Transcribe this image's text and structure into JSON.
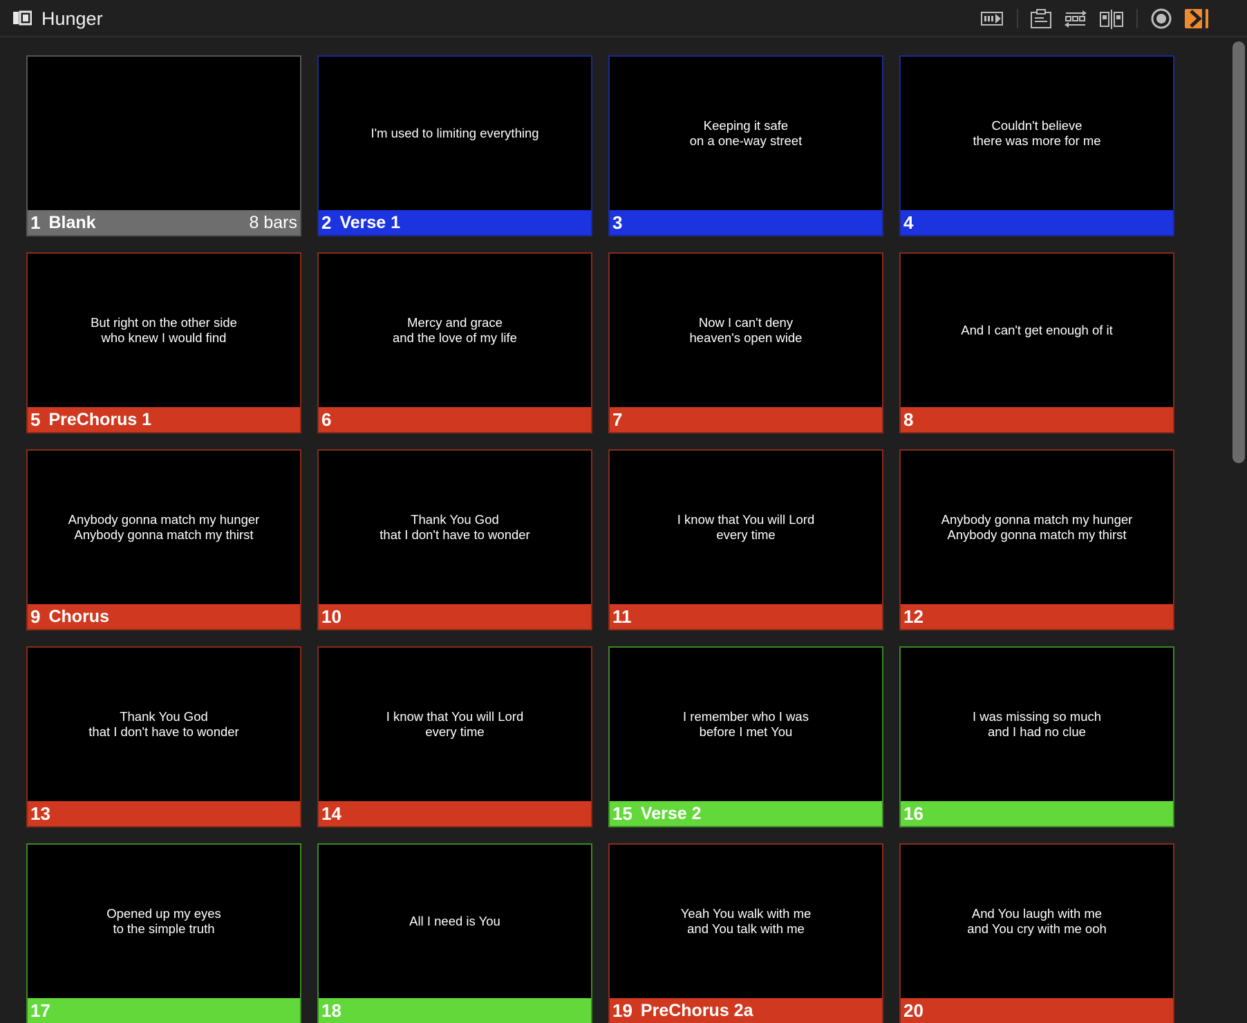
{
  "window": {
    "title": "Hunger"
  },
  "toolbar": {
    "icons": [
      "timeline-icon",
      "notes-icon",
      "transitions-icon",
      "layout-icon",
      "target-icon",
      "play-icon"
    ],
    "accent": "#ef8a2e"
  },
  "colors": {
    "blank": "#6e6e6e",
    "verse1": "#1c33e0",
    "prechorus": "#d0391f",
    "verse2": "#63d83b"
  },
  "slides": [
    {
      "number": "1",
      "group": "Blank",
      "extra": "8 bars",
      "text": "",
      "color": "#6e6e6e",
      "border": "#555555"
    },
    {
      "number": "2",
      "group": "Verse 1",
      "extra": "",
      "text": "I'm used to limiting everything",
      "color": "#1c33e0",
      "border": "#1c2a90"
    },
    {
      "number": "3",
      "group": "",
      "extra": "",
      "text": "Keeping it safe\non a one-way street",
      "color": "#1c33e0",
      "border": "#1c2a90"
    },
    {
      "number": "4",
      "group": "",
      "extra": "",
      "text": "Couldn't believe\nthere was more for me",
      "color": "#1c33e0",
      "border": "#1c2a90"
    },
    {
      "number": "5",
      "group": "PreChorus 1",
      "extra": "",
      "text": "But right on the other side\nwho knew I would find",
      "color": "#d0391f",
      "border": "#8a2a1a"
    },
    {
      "number": "6",
      "group": "",
      "extra": "",
      "text": "Mercy and grace\nand the love of my life",
      "color": "#d0391f",
      "border": "#8a2a1a"
    },
    {
      "number": "7",
      "group": "",
      "extra": "",
      "text": "Now I can't deny\nheaven's open wide",
      "color": "#d0391f",
      "border": "#8a2a1a"
    },
    {
      "number": "8",
      "group": "",
      "extra": "",
      "text": "And I can't get enough of it",
      "color": "#d0391f",
      "border": "#8a2a1a"
    },
    {
      "number": "9",
      "group": "Chorus",
      "extra": "",
      "text": "Anybody gonna match my hunger\nAnybody gonna match my thirst",
      "color": "#d0391f",
      "border": "#8a2a1a"
    },
    {
      "number": "10",
      "group": "",
      "extra": "",
      "text": "Thank You God\nthat I don't have to wonder",
      "color": "#d0391f",
      "border": "#8a2a1a"
    },
    {
      "number": "11",
      "group": "",
      "extra": "",
      "text": "I know that You will Lord\nevery time",
      "color": "#d0391f",
      "border": "#8a2a1a"
    },
    {
      "number": "12",
      "group": "",
      "extra": "",
      "text": "Anybody gonna match my hunger\nAnybody gonna match my thirst",
      "color": "#d0391f",
      "border": "#8a2a1a"
    },
    {
      "number": "13",
      "group": "",
      "extra": "",
      "text": "Thank You God\nthat I don't have to wonder",
      "color": "#d0391f",
      "border": "#8a2a1a"
    },
    {
      "number": "14",
      "group": "",
      "extra": "",
      "text": "I know that You will Lord\nevery time",
      "color": "#d0391f",
      "border": "#8a2a1a"
    },
    {
      "number": "15",
      "group": "Verse 2",
      "extra": "",
      "text": "I remember who I was\nbefore I met You",
      "color": "#63d83b",
      "border": "#3a8a24"
    },
    {
      "number": "16",
      "group": "",
      "extra": "",
      "text": "I was missing so much\nand I had no clue",
      "color": "#63d83b",
      "border": "#3a8a24"
    },
    {
      "number": "17",
      "group": "",
      "extra": "",
      "text": "Opened up my eyes\nto the simple truth",
      "color": "#63d83b",
      "border": "#3a8a24"
    },
    {
      "number": "18",
      "group": "",
      "extra": "",
      "text": "All I need is You",
      "color": "#63d83b",
      "border": "#3a8a24"
    },
    {
      "number": "19",
      "group": "PreChorus 2a",
      "extra": "",
      "text": "Yeah You walk with me\nand You talk with me",
      "color": "#d0391f",
      "border": "#8a2a1a"
    },
    {
      "number": "20",
      "group": "",
      "extra": "",
      "text": "And You laugh with me\nand You cry with me ooh",
      "color": "#d0391f",
      "border": "#8a2a1a"
    }
  ]
}
